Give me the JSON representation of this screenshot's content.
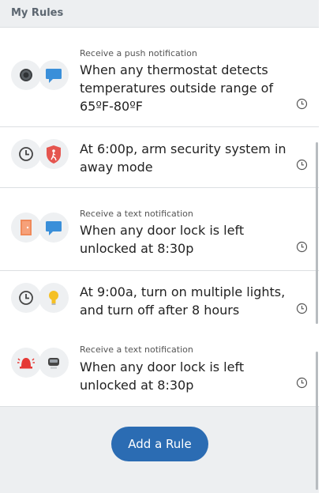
{
  "header": {
    "title": "My Rules"
  },
  "rules": [
    {
      "subtitle": "Receive a push notification",
      "text": "When any thermostat detects temperatures outside range of 65ºF-80ºF",
      "icon1": "thermostat-icon",
      "icon2": "chat-message-icon"
    },
    {
      "subtitle": "",
      "text": "At 6:00p, arm security system in away mode",
      "icon1": "clock-icon",
      "icon2": "security-shield-icon"
    },
    {
      "subtitle": "Receive a text notification",
      "text": "When any door lock is left unlocked at 8:30p",
      "icon1": "door-icon",
      "icon2": "chat-message-icon"
    },
    {
      "subtitle": "",
      "text": "At 9:00a, turn on multiple lights, and turn off after 8 hours",
      "icon1": "clock-icon",
      "icon2": "lightbulb-icon"
    },
    {
      "subtitle": "Receive a text notification",
      "text": "When any door lock is left unlocked at 8:30p",
      "icon1": "alarm-bell-icon",
      "icon2": "camera-icon"
    }
  ],
  "actions": {
    "add_rule_label": "Add a Rule"
  },
  "colors": {
    "accent": "#2b6cb3",
    "chat": "#3a8fd9",
    "shield": "#e5554f",
    "door": "#f08a5a",
    "bulb": "#f5c024",
    "bell": "#e53935"
  }
}
